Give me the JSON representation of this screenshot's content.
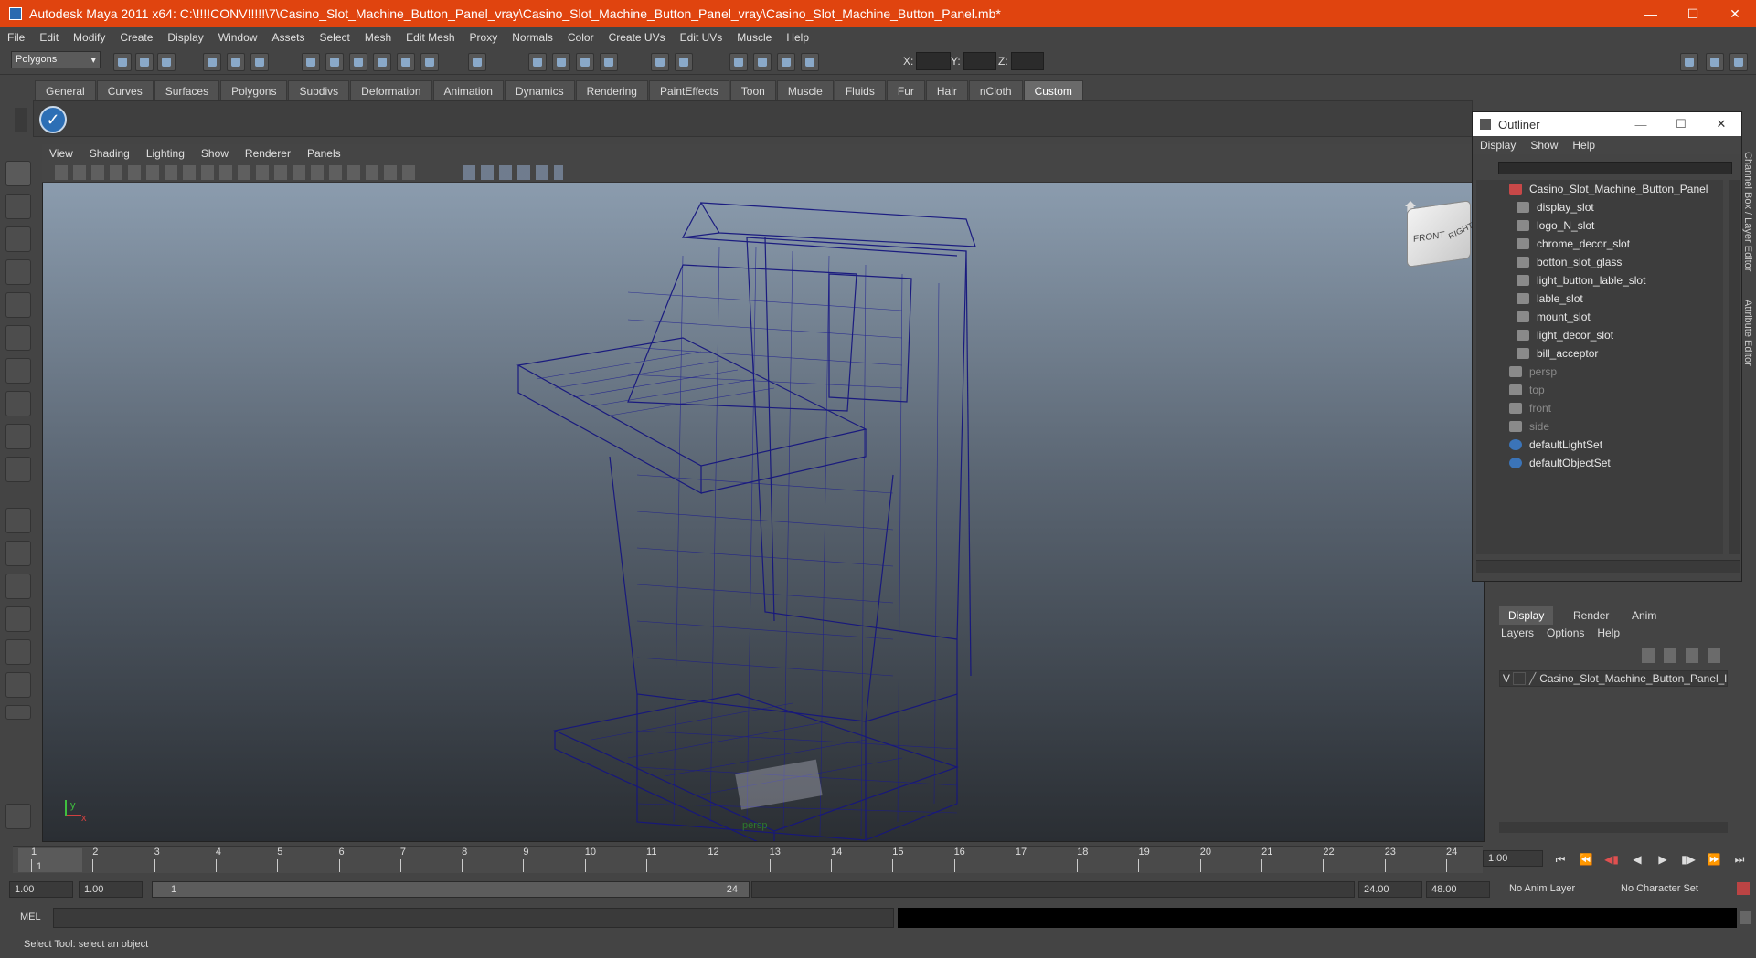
{
  "window": {
    "title": "Autodesk Maya 2011 x64: C:\\!!!!CONV!!!!!\\7\\Casino_Slot_Machine_Button_Panel_vray\\Casino_Slot_Machine_Button_Panel_vray\\Casino_Slot_Machine_Button_Panel.mb*",
    "minimize": "—",
    "maximize": "☐",
    "close": "✕"
  },
  "menubar": [
    "File",
    "Edit",
    "Modify",
    "Create",
    "Display",
    "Window",
    "Assets",
    "Select",
    "Mesh",
    "Edit Mesh",
    "Proxy",
    "Normals",
    "Color",
    "Create UVs",
    "Edit UVs",
    "Muscle",
    "Help"
  ],
  "statusline": {
    "mode": "Polygons",
    "x_label": "X:",
    "y_label": "Y:",
    "z_label": "Z:"
  },
  "shelf_tabs": [
    "General",
    "Curves",
    "Surfaces",
    "Polygons",
    "Subdivs",
    "Deformation",
    "Animation",
    "Dynamics",
    "Rendering",
    "PaintEffects",
    "Toon",
    "Muscle",
    "Fluids",
    "Fur",
    "Hair",
    "nCloth",
    "Custom"
  ],
  "shelf_active": "Custom",
  "panel_menu": [
    "View",
    "Shading",
    "Lighting",
    "Show",
    "Renderer",
    "Panels"
  ],
  "viewport": {
    "camera": "persp",
    "viewcube_front": "FRONT",
    "viewcube_right": "RIGHT",
    "axis_y": "y",
    "axis_x": "x"
  },
  "outliner": {
    "title": "Outliner",
    "menu": [
      "Display",
      "Show",
      "Help"
    ],
    "items": [
      {
        "label": "Casino_Slot_Machine_Button_Panel",
        "dim": false,
        "indent": 0
      },
      {
        "label": "display_slot",
        "dim": false,
        "indent": 1
      },
      {
        "label": "logo_N_slot",
        "dim": false,
        "indent": 1
      },
      {
        "label": "chrome_decor_slot",
        "dim": false,
        "indent": 1
      },
      {
        "label": "botton_slot_glass",
        "dim": false,
        "indent": 1
      },
      {
        "label": "light_button_lable_slot",
        "dim": false,
        "indent": 1
      },
      {
        "label": "lable_slot",
        "dim": false,
        "indent": 1
      },
      {
        "label": "mount_slot",
        "dim": false,
        "indent": 1
      },
      {
        "label": "light_decor_slot",
        "dim": false,
        "indent": 1
      },
      {
        "label": "bill_acceptor",
        "dim": false,
        "indent": 1
      },
      {
        "label": "persp",
        "dim": true,
        "indent": 0
      },
      {
        "label": "top",
        "dim": true,
        "indent": 0
      },
      {
        "label": "front",
        "dim": true,
        "indent": 0
      },
      {
        "label": "side",
        "dim": true,
        "indent": 0
      },
      {
        "label": "defaultLightSet",
        "dim": false,
        "indent": 0
      },
      {
        "label": "defaultObjectSet",
        "dim": false,
        "indent": 0
      }
    ]
  },
  "layer_editor": {
    "tabs": [
      "Display",
      "Render",
      "Anim"
    ],
    "active_tab": "Display",
    "menu": [
      "Layers",
      "Options",
      "Help"
    ],
    "layer_visibility": "V",
    "layer_name": "Casino_Slot_Machine_Button_Panel_l"
  },
  "side_tabs": {
    "channel_box": "Channel Box / Layer Editor",
    "attribute_editor": "Attribute Editor"
  },
  "timeline": {
    "ticks": [
      "1",
      "2",
      "3",
      "4",
      "5",
      "6",
      "7",
      "8",
      "9",
      "10",
      "11",
      "12",
      "13",
      "14",
      "15",
      "16",
      "17",
      "18",
      "19",
      "20",
      "21",
      "22",
      "23",
      "24"
    ],
    "current_frame": "1",
    "current_time_field": "1.00"
  },
  "range": {
    "start_time": "1.00",
    "playback_start": "1.00",
    "slider_start": "1",
    "slider_end": "24",
    "playback_end": "24.00",
    "end_time": "48.00",
    "anim_layer": "No Anim Layer",
    "character_set": "No Character Set"
  },
  "command_line": {
    "label": "MEL"
  },
  "help_line": "Select Tool: select an object",
  "colors": {
    "title_bar": "#e0440f",
    "wireframe": "#1a1a8c",
    "panel": "#444444"
  }
}
